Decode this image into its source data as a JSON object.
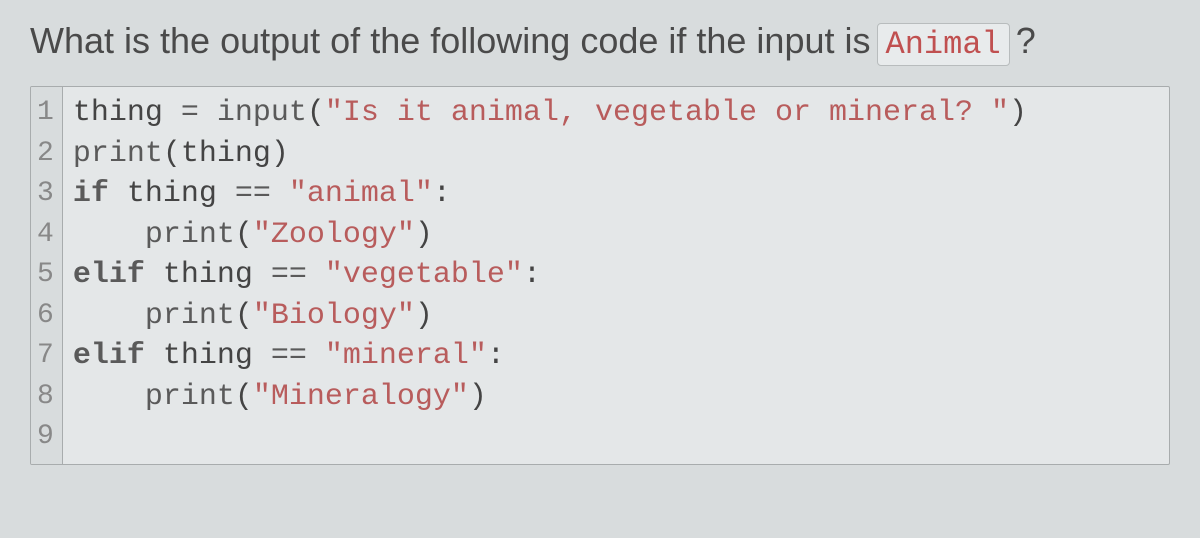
{
  "question": {
    "text": "What is the output of the following code if the input is",
    "input_value": "Animal",
    "qmark": "?"
  },
  "code": {
    "line_numbers": [
      "1",
      "2",
      "3",
      "4",
      "5",
      "6",
      "7",
      "8",
      "9"
    ],
    "lines": [
      {
        "tokens": [
          {
            "t": "thing ",
            "c": ""
          },
          {
            "t": "=",
            "c": "op"
          },
          {
            "t": " ",
            "c": ""
          },
          {
            "t": "input",
            "c": "builtin"
          },
          {
            "t": "(",
            "c": ""
          },
          {
            "t": "\"Is it animal, vegetable or mineral? \"",
            "c": "str"
          },
          {
            "t": ")",
            "c": ""
          }
        ]
      },
      {
        "tokens": [
          {
            "t": "print",
            "c": "builtin"
          },
          {
            "t": "(thing)",
            "c": ""
          }
        ]
      },
      {
        "tokens": [
          {
            "t": "if",
            "c": "kw"
          },
          {
            "t": " thing ",
            "c": ""
          },
          {
            "t": "==",
            "c": "op"
          },
          {
            "t": " ",
            "c": ""
          },
          {
            "t": "\"animal\"",
            "c": "str"
          },
          {
            "t": ":",
            "c": ""
          }
        ]
      },
      {
        "tokens": [
          {
            "t": "    ",
            "c": ""
          },
          {
            "t": "print",
            "c": "builtin"
          },
          {
            "t": "(",
            "c": ""
          },
          {
            "t": "\"Zoology\"",
            "c": "str"
          },
          {
            "t": ")",
            "c": ""
          }
        ]
      },
      {
        "tokens": [
          {
            "t": "elif",
            "c": "kw"
          },
          {
            "t": " thing ",
            "c": ""
          },
          {
            "t": "==",
            "c": "op"
          },
          {
            "t": " ",
            "c": ""
          },
          {
            "t": "\"vegetable\"",
            "c": "str"
          },
          {
            "t": ":",
            "c": ""
          }
        ]
      },
      {
        "tokens": [
          {
            "t": "    ",
            "c": ""
          },
          {
            "t": "print",
            "c": "builtin"
          },
          {
            "t": "(",
            "c": ""
          },
          {
            "t": "\"Biology\"",
            "c": "str"
          },
          {
            "t": ")",
            "c": ""
          }
        ]
      },
      {
        "tokens": [
          {
            "t": "elif",
            "c": "kw"
          },
          {
            "t": " thing ",
            "c": ""
          },
          {
            "t": "==",
            "c": "op"
          },
          {
            "t": " ",
            "c": ""
          },
          {
            "t": "\"mineral\"",
            "c": "str"
          },
          {
            "t": ":",
            "c": ""
          }
        ]
      },
      {
        "tokens": [
          {
            "t": "    ",
            "c": ""
          },
          {
            "t": "print",
            "c": "builtin"
          },
          {
            "t": "(",
            "c": ""
          },
          {
            "t": "\"Mineralogy\"",
            "c": "str"
          },
          {
            "t": ")",
            "c": ""
          }
        ]
      },
      {
        "tokens": [
          {
            "t": "",
            "c": ""
          }
        ]
      }
    ]
  }
}
